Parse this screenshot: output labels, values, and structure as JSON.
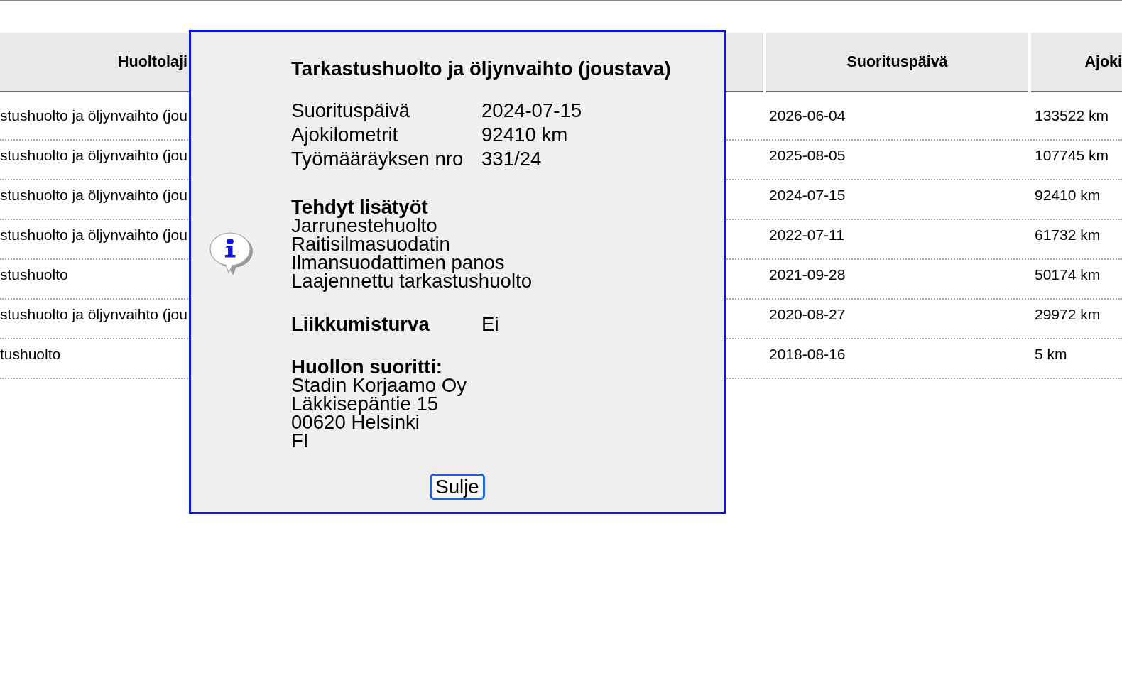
{
  "table": {
    "columns": [
      {
        "label": "Huoltolaji"
      },
      {
        "label": "Suorituspäivä"
      },
      {
        "label": "Ajoki"
      }
    ],
    "rows": [
      {
        "cells": [
          "stushuolto ja öljynvaihto (jou",
          "2026-06-04",
          "133522 km"
        ]
      },
      {
        "cells": [
          "stushuolto ja öljynvaihto (jou",
          "2025-08-05",
          "107745 km"
        ]
      },
      {
        "cells": [
          "stushuolto ja öljynvaihto (jou",
          "2024-07-15",
          "92410 km"
        ]
      },
      {
        "cells": [
          "stushuolto ja öljynvaihto (jou",
          "2022-07-11",
          "61732 km"
        ]
      },
      {
        "cells": [
          "stushuolto",
          "2021-09-28",
          "50174 km"
        ]
      },
      {
        "cells": [
          "stushuolto ja öljynvaihto (jou",
          "2020-08-27",
          "29972 km"
        ]
      },
      {
        "cells": [
          "tushuolto",
          "2018-08-16",
          "5 km"
        ]
      }
    ]
  },
  "dialog": {
    "title": "Tarkastushuolto ja öljynvaihto (joustava)",
    "details": [
      {
        "label": "Suorituspäivä",
        "value": "2024-07-15"
      },
      {
        "label": "Ajokilometrit",
        "value": "92410 km"
      },
      {
        "label": "Työmääräyksen nro",
        "value": "331/24"
      }
    ],
    "extra_work": {
      "heading": "Tehdyt lisätyöt",
      "items": [
        "Jarrunestehuolto",
        "Raitisilmasuodatin",
        "Ilmansuodattimen panos",
        "Laajennettu tarkastushuolto"
      ]
    },
    "mobility": {
      "label": "Liikkumisturva",
      "value": "Ei"
    },
    "performed_by": {
      "heading": "Huollon suoritti:",
      "lines": [
        "Stadin Korjaamo Oy",
        "Läkkisepäntie 15",
        "00620 Helsinki",
        "FI"
      ]
    },
    "close_button": "Sulje"
  }
}
